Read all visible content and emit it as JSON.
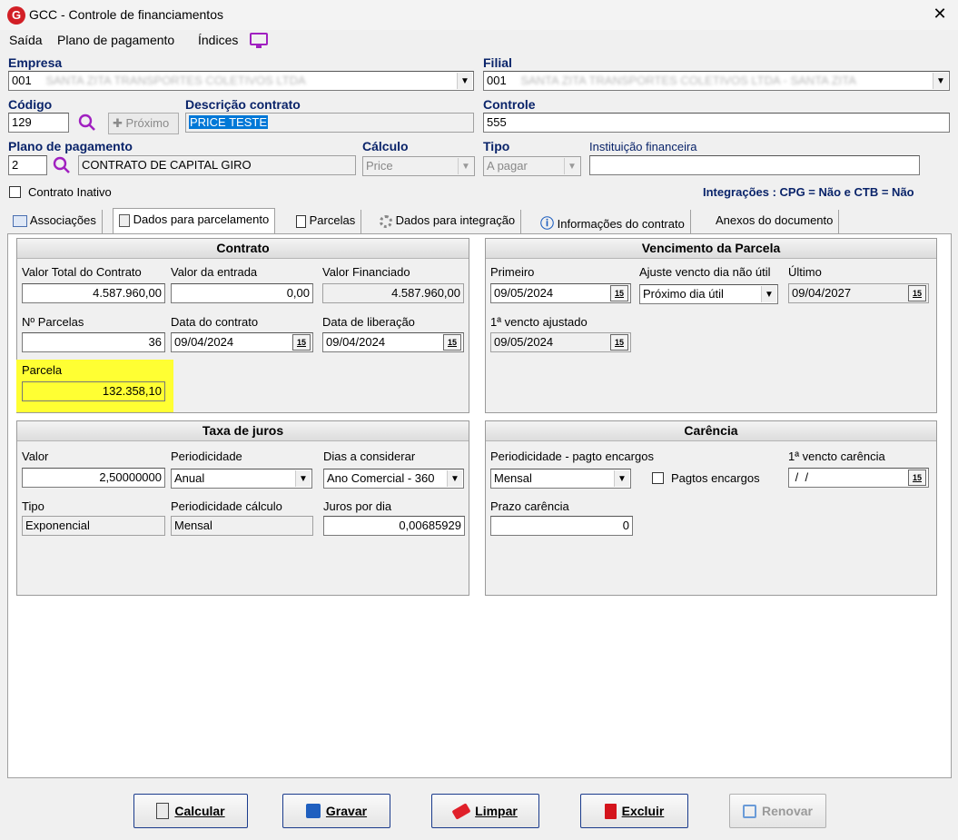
{
  "window": {
    "title": "GCC - Controle de financiamentos",
    "close_glyph": "✕"
  },
  "menu": [
    "Saída",
    "Plano de pagamento",
    "Índices"
  ],
  "header": {
    "empresa_label": "Empresa",
    "empresa_code": "001",
    "empresa_name_blurred": "SANTA ZITA TRANSPORTES COLETIVOS LTDA",
    "filial_label": "Filial",
    "filial_code": "001",
    "filial_name_blurred": "SANTA ZITA TRANSPORTES COLETIVOS LTDA - SANTA ZITA",
    "codigo_label": "Código",
    "codigo_value": "129",
    "proximo_label": "Próximo",
    "descricao_label": "Descrição contrato",
    "descricao_value": "PRICE TESTE",
    "controle_label": "Controle",
    "controle_value": "555",
    "plano_label": "Plano de pagamento",
    "plano_code": "2",
    "plano_name": "CONTRATO DE CAPITAL GIRO",
    "calculo_label": "Cálculo",
    "calculo_value": "Price",
    "tipo_label": "Tipo",
    "tipo_value": "A pagar",
    "instituicao_label": "Instituição financeira",
    "instituicao_value": "",
    "inativo_label": "Contrato Inativo",
    "integracoes": "Integrações : CPG = Não e CTB = Não"
  },
  "tabs": [
    "Associações",
    "Dados para parcelamento",
    "Parcelas",
    "Dados para integração",
    "Informações do contrato",
    "Anexos do documento"
  ],
  "contrato": {
    "title": "Contrato",
    "valor_total_label": "Valor Total do Contrato",
    "valor_total": "4.587.960,00",
    "valor_entrada_label": "Valor da entrada",
    "valor_entrada": "0,00",
    "valor_financiado_label": "Valor Financiado",
    "valor_financiado": "4.587.960,00",
    "parcelas_label": "Nº Parcelas",
    "parcelas": "36",
    "data_contrato_label": "Data do contrato",
    "data_contrato": "09/04/2024",
    "data_liberacao_label": "Data de liberação",
    "data_liberacao": "09/04/2024",
    "parcela_label": "Parcela",
    "parcela": "132.358,10"
  },
  "vencimento": {
    "title": "Vencimento da Parcela",
    "primeiro_label": "Primeiro",
    "primeiro": "09/05/2024",
    "ajuste_label": "Ajuste vencto dia não útil",
    "ajuste": "Próximo dia útil",
    "ultimo_label": "Último",
    "ultimo": "09/04/2027",
    "ajustado_label": "1ª vencto ajustado",
    "ajustado": "09/05/2024"
  },
  "juros": {
    "title": "Taxa de juros",
    "valor_label": "Valor",
    "valor": "2,50000000",
    "periodicidade_label": "Periodicidade",
    "periodicidade": "Anual",
    "dias_label": "Dias a considerar",
    "dias": "Ano Comercial - 360",
    "tipo_label": "Tipo",
    "tipo": "Exponencial",
    "per_calc_label": "Periodicidade cálculo",
    "per_calc": "Mensal",
    "juros_dia_label": "Juros por dia",
    "juros_dia": "0,00685929"
  },
  "carencia": {
    "title": "Carência",
    "per_encargos_label": "Periodicidade - pagto encargos",
    "per_encargos": "Mensal",
    "pagtos_label": "Pagtos encargos",
    "vencto_carencia_label": "1ª vencto carência",
    "vencto_carencia": " /  /",
    "prazo_label": "Prazo carência",
    "prazo": "0"
  },
  "calendar_glyph": "15",
  "buttons": [
    "Calcular",
    "Gravar",
    "Limpar",
    "Excluir",
    "Renovar"
  ],
  "colors": {
    "label_blue": "#0a246a",
    "highlight": "#ffff33",
    "selection": "#0078d7",
    "brand_red": "#d21f26"
  }
}
